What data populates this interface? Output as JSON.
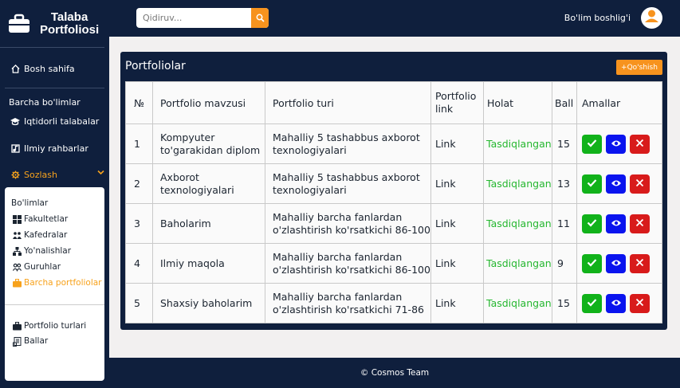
{
  "brand": {
    "title_line1": "Talaba",
    "title_line2": "Portfoliosi"
  },
  "sidebar": {
    "home_label": "Bosh sahifa",
    "section_label": "Barcha bo'limlar",
    "items": [
      {
        "label": "Iqtidorli talabalar",
        "icon": "graduation-cap-icon"
      },
      {
        "label": "Ilmiy rahbarlar",
        "icon": "music-note-icon"
      }
    ],
    "settings_label": "Sozlash",
    "submenu": {
      "heading": "Bo'limlar",
      "items": [
        {
          "label": "Fakultetlar",
          "icon": "grid-icon"
        },
        {
          "label": "Kafedralar",
          "icon": "people-icon"
        },
        {
          "label": "Yo'nalishlar",
          "icon": "sitemap-icon"
        },
        {
          "label": "Guruhlar",
          "icon": "group-icon"
        },
        {
          "label": "Barcha portfoliolar",
          "icon": "briefcase-icon"
        }
      ],
      "extra_items": [
        {
          "label": "Portfolio turlari",
          "icon": "briefcase-icon"
        },
        {
          "label": "Ballar",
          "icon": "document-icon"
        }
      ]
    }
  },
  "header": {
    "search_placeholder": "Qidiruv...",
    "user_name": "Bo'lim boshlig'i"
  },
  "panel": {
    "title": "Portfoliolar",
    "add_button": "+Qo'shish"
  },
  "table": {
    "headers": [
      "№",
      "Portfolio mavzusi",
      "Portfolio turi",
      "Portfolio link",
      "Holat",
      "Ball",
      "Amallar"
    ],
    "rows": [
      {
        "num": "1",
        "topic": "Kompyuter to'garakidan diplom",
        "type": "Mahalliy 5 tashabbus axborot texnologiyalari",
        "link": "Link",
        "status": "Tasdiqlangan",
        "score": "15"
      },
      {
        "num": "2",
        "topic": "Axborot texnologiyalari",
        "type": "Mahalliy 5 tashabbus axborot texnologiyalari",
        "link": "Link",
        "status": "Tasdiqlangan",
        "score": "13"
      },
      {
        "num": "3",
        "topic": "Baholarim",
        "type": "Mahalliy barcha fanlardan o'zlashtirish ko'rsatkichi 86-100",
        "link": "Link",
        "status": "Tasdiqlangan",
        "score": "11"
      },
      {
        "num": "4",
        "topic": "Ilmiy maqola",
        "type": "Mahalliy barcha fanlardan o'zlashtirish ko'rsatkichi 86-100",
        "link": "Link",
        "status": "Tasdiqlangan",
        "score": "9"
      },
      {
        "num": "5",
        "topic": "Shaxsiy baholarim",
        "type": "Mahalliy barcha fanlardan o'zlashtirish ko'rsatkichi 71-86",
        "link": "Link",
        "status": "Tasdiqlangan",
        "score": "15"
      }
    ]
  },
  "footer": {
    "text": "© Cosmos Team"
  },
  "colors": {
    "navy": "#0f1f3d",
    "accent": "#f7931e",
    "success": "#25b72f",
    "view": "#0a14ef",
    "delete": "#d81b1b"
  }
}
